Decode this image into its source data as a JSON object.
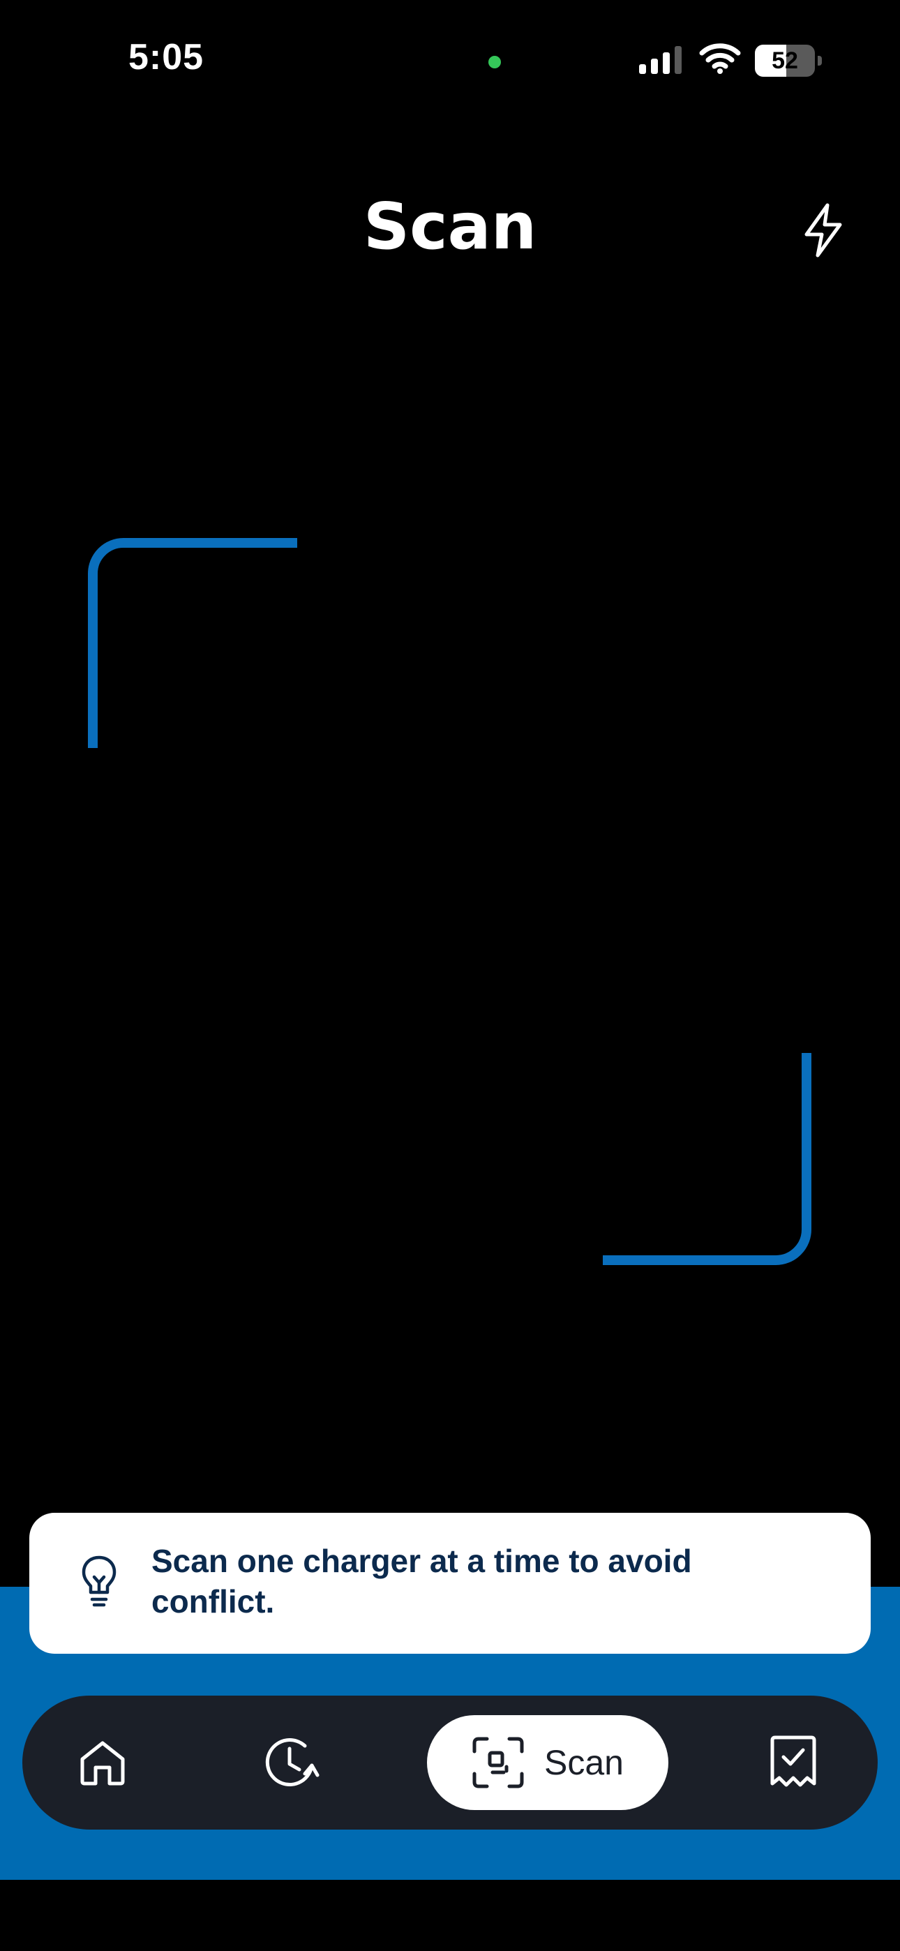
{
  "status_bar": {
    "time": "5:05",
    "battery_level": "52",
    "battery_fraction": 0.52
  },
  "header": {
    "title": "Scan",
    "flash_icon": "lightning-bolt-icon"
  },
  "tip": {
    "icon": "lightbulb-icon",
    "text": "Scan one charger at a time to avoid conflict."
  },
  "bottom_nav": {
    "items": [
      {
        "id": "home",
        "icon": "home-icon",
        "label": ""
      },
      {
        "id": "history",
        "icon": "history-clock-icon",
        "label": ""
      },
      {
        "id": "scan",
        "icon": "scan-frame-icon",
        "label": "Scan",
        "active": true
      },
      {
        "id": "receipts",
        "icon": "receipt-check-icon",
        "label": ""
      }
    ]
  },
  "colors": {
    "accent_blue": "#006bb2",
    "frame_blue": "#0a6fbd",
    "nav_bg": "#1b1f28",
    "tip_text": "#0c2a4d",
    "privacy_dot": "#35c759"
  }
}
